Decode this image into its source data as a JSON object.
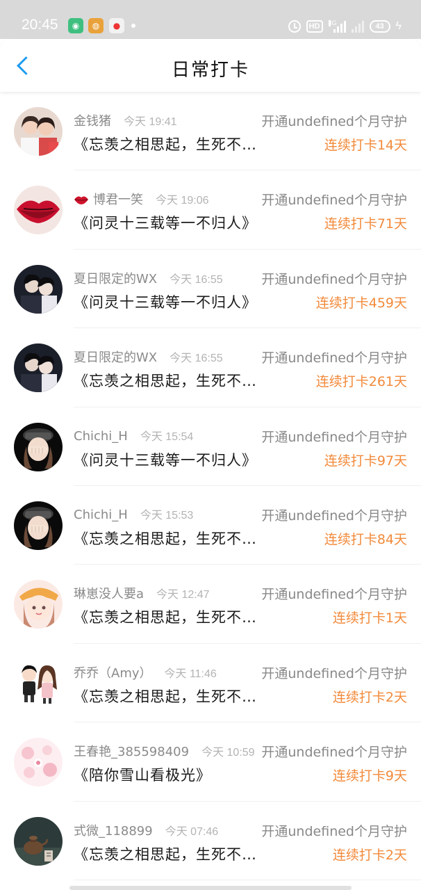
{
  "status_bar": {
    "time": "20:45",
    "hd_label": "HD",
    "network_label": "4G",
    "battery_level": "43",
    "icons": [
      "wechat-app-icon",
      "weibo-app-icon",
      "map-app-icon",
      "alarm-icon",
      "signal-icon",
      "battery-icon"
    ]
  },
  "header": {
    "title": "日常打卡",
    "back_icon": "chevron-left-icon",
    "accent_color": "#1e9bf0"
  },
  "colors": {
    "streak": "#f28a3b",
    "name": "#8a8a8a",
    "time": "#b3b3b3"
  },
  "items": [
    {
      "name": "金钱猪",
      "time": "今天 19:41",
      "guard": "开通undefined个月守护",
      "title": "《忘羡之相思起，生死不弃》",
      "streak": "连续打卡14天",
      "avatar": "avatar-photo-two-girls"
    },
    {
      "name": "博君一笑",
      "time": "今天 19:06",
      "guard": "开通undefined个月守护",
      "title": "《问灵十三载等一不归人》",
      "streak": "连续打卡71天",
      "avatar": "avatar-red-lips",
      "name_icon": "lips-icon"
    },
    {
      "name": "夏日限定的WX",
      "time": "今天 16:55",
      "guard": "开通undefined个月守护",
      "title": "《问灵十三载等一不归人》",
      "streak": "连续打卡459天",
      "avatar": "avatar-dark-costume"
    },
    {
      "name": "夏日限定的WX",
      "time": "今天 16:55",
      "guard": "开通undefined个月守护",
      "title": "《忘羡之相思起，生死不弃》",
      "streak": "连续打卡261天",
      "avatar": "avatar-dark-costume"
    },
    {
      "name": "Chichi_H",
      "time": "今天 15:54",
      "guard": "开通undefined个月守护",
      "title": "《问灵十三载等一不归人》",
      "streak": "连续打卡97天",
      "avatar": "avatar-cartoon-girl-hat"
    },
    {
      "name": "Chichi_H",
      "time": "今天 15:53",
      "guard": "开通undefined个月守护",
      "title": "《忘羡之相思起，生死不弃》",
      "streak": "连续打卡84天",
      "avatar": "avatar-cartoon-girl-hat"
    },
    {
      "name": "琳崽没人要a",
      "time": "今天 12:47",
      "guard": "开通undefined个月守护",
      "title": "《忘羡之相思起，生死不弃》",
      "streak": "连续打卡1天",
      "avatar": "avatar-anime-girl"
    },
    {
      "name": "乔乔（Amy）",
      "time": "今天 11:46",
      "guard": "开通undefined个月守护",
      "title": "《忘羡之相思起，生死不弃》",
      "streak": "连续打卡2天",
      "avatar": "avatar-cartoon-couple"
    },
    {
      "name": "王春艳_385598409",
      "time": "今天 10:59",
      "guard": "开通undefined个月守护",
      "title": "《陪你雪山看极光》",
      "streak": "连续打卡9天",
      "avatar": "avatar-pink-floral"
    },
    {
      "name": "式微_118899",
      "time": "今天 07:46",
      "guard": "开通undefined个月守护",
      "title": "《忘羡之相思起，生死不弃》",
      "streak": "连续打卡2天",
      "avatar": "avatar-teapot"
    }
  ]
}
